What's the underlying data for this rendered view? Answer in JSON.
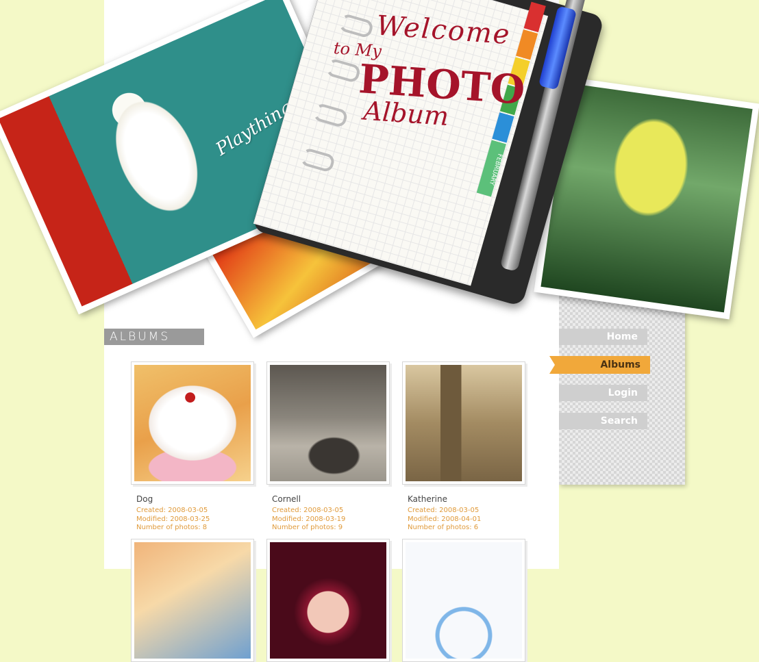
{
  "header": {
    "welcome_line1": "Welcome",
    "welcome_line2": "to My",
    "welcome_line3": "PHOTO",
    "welcome_line4": "Album",
    "photo_caption": "Plaything",
    "planner_tab": "FEBRUARY"
  },
  "section": {
    "title": "ALBUMS"
  },
  "nav": [
    {
      "label": "Home",
      "active": false
    },
    {
      "label": "Albums",
      "active": true
    },
    {
      "label": "Login",
      "active": false
    },
    {
      "label": "Search",
      "active": false
    }
  ],
  "albums": [
    {
      "title": "Dog",
      "created": "Created: 2008-03-05",
      "modified": "Modified: 2008-03-25",
      "count": "Number of photos: 8"
    },
    {
      "title": "Cornell",
      "created": "Created: 2008-03-05",
      "modified": "Modified: 2008-03-19",
      "count": "Number of photos: 9"
    },
    {
      "title": "Katherine",
      "created": "Created: 2008-03-05",
      "modified": "Modified: 2008-04-01",
      "count": "Number of photos: 6"
    }
  ],
  "colors": {
    "background": "#f4f9c7",
    "accent": "#f1a83a",
    "meta_text": "#e09a3a",
    "nav_inactive": "#cfcfcf"
  }
}
